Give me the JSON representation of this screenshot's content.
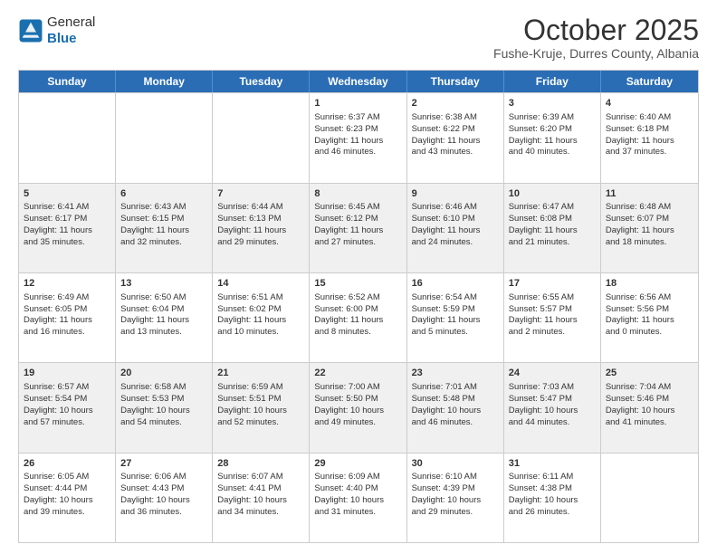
{
  "logo": {
    "general": "General",
    "blue": "Blue"
  },
  "header": {
    "month": "October 2025",
    "location": "Fushe-Kruje, Durres County, Albania"
  },
  "days": [
    "Sunday",
    "Monday",
    "Tuesday",
    "Wednesday",
    "Thursday",
    "Friday",
    "Saturday"
  ],
  "rows": [
    [
      {
        "num": "",
        "lines": []
      },
      {
        "num": "",
        "lines": []
      },
      {
        "num": "",
        "lines": []
      },
      {
        "num": "1",
        "lines": [
          "Sunrise: 6:37 AM",
          "Sunset: 6:23 PM",
          "Daylight: 11 hours",
          "and 46 minutes."
        ]
      },
      {
        "num": "2",
        "lines": [
          "Sunrise: 6:38 AM",
          "Sunset: 6:22 PM",
          "Daylight: 11 hours",
          "and 43 minutes."
        ]
      },
      {
        "num": "3",
        "lines": [
          "Sunrise: 6:39 AM",
          "Sunset: 6:20 PM",
          "Daylight: 11 hours",
          "and 40 minutes."
        ]
      },
      {
        "num": "4",
        "lines": [
          "Sunrise: 6:40 AM",
          "Sunset: 6:18 PM",
          "Daylight: 11 hours",
          "and 37 minutes."
        ]
      }
    ],
    [
      {
        "num": "5",
        "lines": [
          "Sunrise: 6:41 AM",
          "Sunset: 6:17 PM",
          "Daylight: 11 hours",
          "and 35 minutes."
        ]
      },
      {
        "num": "6",
        "lines": [
          "Sunrise: 6:43 AM",
          "Sunset: 6:15 PM",
          "Daylight: 11 hours",
          "and 32 minutes."
        ]
      },
      {
        "num": "7",
        "lines": [
          "Sunrise: 6:44 AM",
          "Sunset: 6:13 PM",
          "Daylight: 11 hours",
          "and 29 minutes."
        ]
      },
      {
        "num": "8",
        "lines": [
          "Sunrise: 6:45 AM",
          "Sunset: 6:12 PM",
          "Daylight: 11 hours",
          "and 27 minutes."
        ]
      },
      {
        "num": "9",
        "lines": [
          "Sunrise: 6:46 AM",
          "Sunset: 6:10 PM",
          "Daylight: 11 hours",
          "and 24 minutes."
        ]
      },
      {
        "num": "10",
        "lines": [
          "Sunrise: 6:47 AM",
          "Sunset: 6:08 PM",
          "Daylight: 11 hours",
          "and 21 minutes."
        ]
      },
      {
        "num": "11",
        "lines": [
          "Sunrise: 6:48 AM",
          "Sunset: 6:07 PM",
          "Daylight: 11 hours",
          "and 18 minutes."
        ]
      }
    ],
    [
      {
        "num": "12",
        "lines": [
          "Sunrise: 6:49 AM",
          "Sunset: 6:05 PM",
          "Daylight: 11 hours",
          "and 16 minutes."
        ]
      },
      {
        "num": "13",
        "lines": [
          "Sunrise: 6:50 AM",
          "Sunset: 6:04 PM",
          "Daylight: 11 hours",
          "and 13 minutes."
        ]
      },
      {
        "num": "14",
        "lines": [
          "Sunrise: 6:51 AM",
          "Sunset: 6:02 PM",
          "Daylight: 11 hours",
          "and 10 minutes."
        ]
      },
      {
        "num": "15",
        "lines": [
          "Sunrise: 6:52 AM",
          "Sunset: 6:00 PM",
          "Daylight: 11 hours",
          "and 8 minutes."
        ]
      },
      {
        "num": "16",
        "lines": [
          "Sunrise: 6:54 AM",
          "Sunset: 5:59 PM",
          "Daylight: 11 hours",
          "and 5 minutes."
        ]
      },
      {
        "num": "17",
        "lines": [
          "Sunrise: 6:55 AM",
          "Sunset: 5:57 PM",
          "Daylight: 11 hours",
          "and 2 minutes."
        ]
      },
      {
        "num": "18",
        "lines": [
          "Sunrise: 6:56 AM",
          "Sunset: 5:56 PM",
          "Daylight: 11 hours",
          "and 0 minutes."
        ]
      }
    ],
    [
      {
        "num": "19",
        "lines": [
          "Sunrise: 6:57 AM",
          "Sunset: 5:54 PM",
          "Daylight: 10 hours",
          "and 57 minutes."
        ]
      },
      {
        "num": "20",
        "lines": [
          "Sunrise: 6:58 AM",
          "Sunset: 5:53 PM",
          "Daylight: 10 hours",
          "and 54 minutes."
        ]
      },
      {
        "num": "21",
        "lines": [
          "Sunrise: 6:59 AM",
          "Sunset: 5:51 PM",
          "Daylight: 10 hours",
          "and 52 minutes."
        ]
      },
      {
        "num": "22",
        "lines": [
          "Sunrise: 7:00 AM",
          "Sunset: 5:50 PM",
          "Daylight: 10 hours",
          "and 49 minutes."
        ]
      },
      {
        "num": "23",
        "lines": [
          "Sunrise: 7:01 AM",
          "Sunset: 5:48 PM",
          "Daylight: 10 hours",
          "and 46 minutes."
        ]
      },
      {
        "num": "24",
        "lines": [
          "Sunrise: 7:03 AM",
          "Sunset: 5:47 PM",
          "Daylight: 10 hours",
          "and 44 minutes."
        ]
      },
      {
        "num": "25",
        "lines": [
          "Sunrise: 7:04 AM",
          "Sunset: 5:46 PM",
          "Daylight: 10 hours",
          "and 41 minutes."
        ]
      }
    ],
    [
      {
        "num": "26",
        "lines": [
          "Sunrise: 6:05 AM",
          "Sunset: 4:44 PM",
          "Daylight: 10 hours",
          "and 39 minutes."
        ]
      },
      {
        "num": "27",
        "lines": [
          "Sunrise: 6:06 AM",
          "Sunset: 4:43 PM",
          "Daylight: 10 hours",
          "and 36 minutes."
        ]
      },
      {
        "num": "28",
        "lines": [
          "Sunrise: 6:07 AM",
          "Sunset: 4:41 PM",
          "Daylight: 10 hours",
          "and 34 minutes."
        ]
      },
      {
        "num": "29",
        "lines": [
          "Sunrise: 6:09 AM",
          "Sunset: 4:40 PM",
          "Daylight: 10 hours",
          "and 31 minutes."
        ]
      },
      {
        "num": "30",
        "lines": [
          "Sunrise: 6:10 AM",
          "Sunset: 4:39 PM",
          "Daylight: 10 hours",
          "and 29 minutes."
        ]
      },
      {
        "num": "31",
        "lines": [
          "Sunrise: 6:11 AM",
          "Sunset: 4:38 PM",
          "Daylight: 10 hours",
          "and 26 minutes."
        ]
      },
      {
        "num": "",
        "lines": []
      }
    ]
  ]
}
